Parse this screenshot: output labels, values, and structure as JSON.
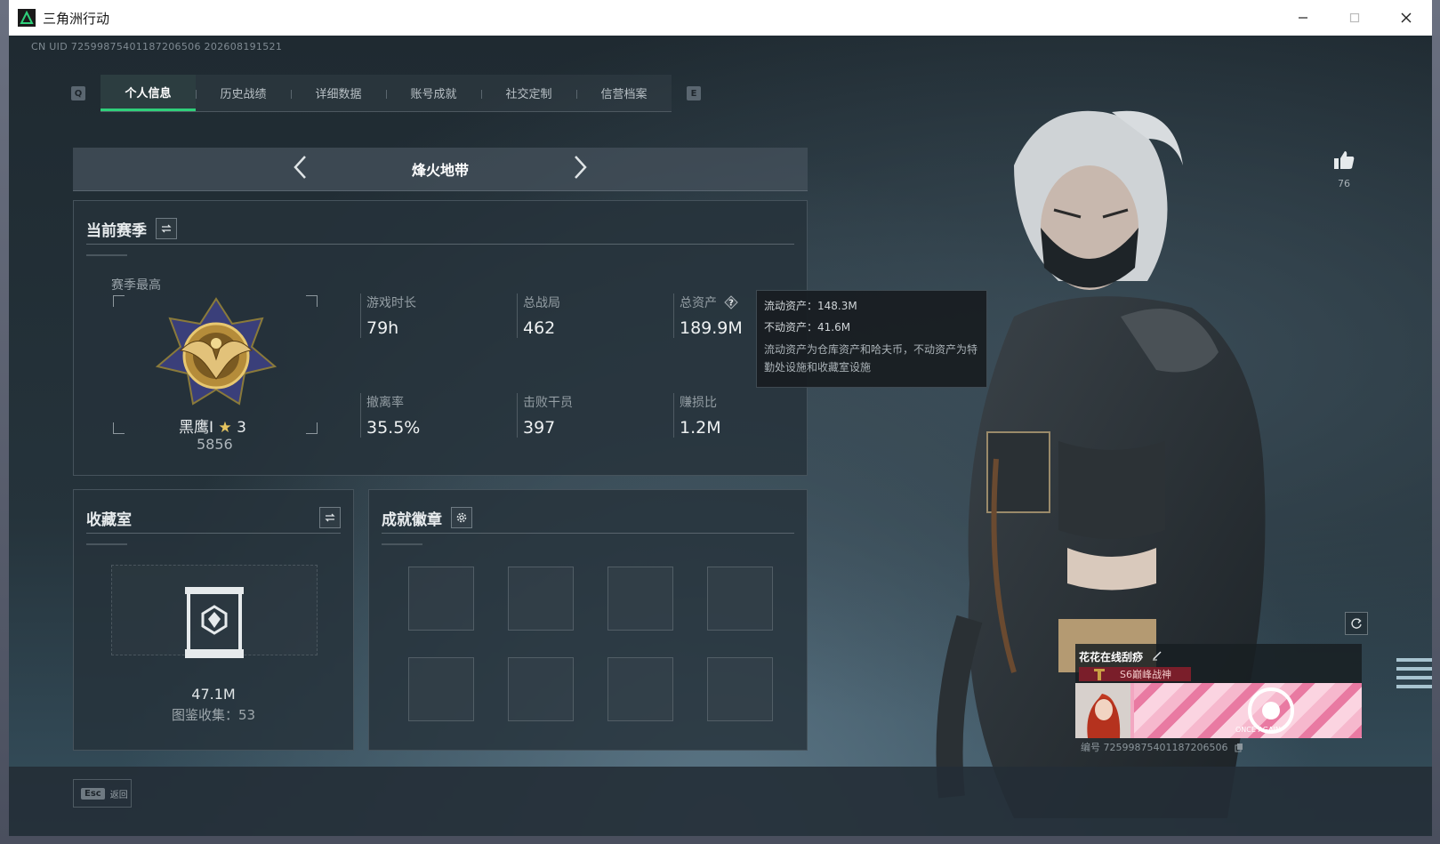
{
  "window": {
    "title": "三角洲行动"
  },
  "header": {
    "uid": "CN UID 7259987540118720650​6 202608191521",
    "key_prev": "Q",
    "key_next": "E",
    "tabs": [
      {
        "label": "个人信息",
        "active": true
      },
      {
        "label": "历史战绩",
        "active": false
      },
      {
        "label": "详细数据",
        "active": false
      },
      {
        "label": "账号成就",
        "active": false
      },
      {
        "label": "社交定制",
        "active": false
      },
      {
        "label": "信营档案",
        "active": false
      }
    ]
  },
  "mode": {
    "title": "烽火地带"
  },
  "season": {
    "title": "当前赛季",
    "best_label": "赛季最高",
    "rank_name": "黑鹰I",
    "rank_stars": "3",
    "rank_score": "5856",
    "stats": [
      {
        "label": "游戏时长",
        "value": "79h"
      },
      {
        "label": "总战局",
        "value": "462"
      },
      {
        "label": "总资产",
        "value": "189.9M"
      },
      {
        "label": "撤离率",
        "value": "35.5%"
      },
      {
        "label": "击败干员",
        "value": "397"
      },
      {
        "label": "赚损比",
        "value": "1.2M"
      }
    ]
  },
  "tooltip": {
    "liquid": "流动资产：148.3M",
    "fixed": "不动资产：41.6M",
    "note": "流动资产为仓库资产和哈夫币，不动资产为特勤处设施和收藏室设施"
  },
  "collection": {
    "title": "收藏室",
    "value": "47.1M",
    "sub": "图鉴收集：53"
  },
  "achievements": {
    "title": "成就徽章"
  },
  "footer": {
    "esc_key": "Esc",
    "esc_label": "返回"
  },
  "profile": {
    "likes": "76",
    "name": "花花在线刮痧",
    "badge": "S6巅峰战神",
    "banner_text": "ONCE AGAIN",
    "id": "编号 7259987540118720650​6"
  },
  "colors": {
    "accent": "#2fd07a",
    "banner": "#f2a7c1",
    "badge": "#7a1e2a"
  }
}
